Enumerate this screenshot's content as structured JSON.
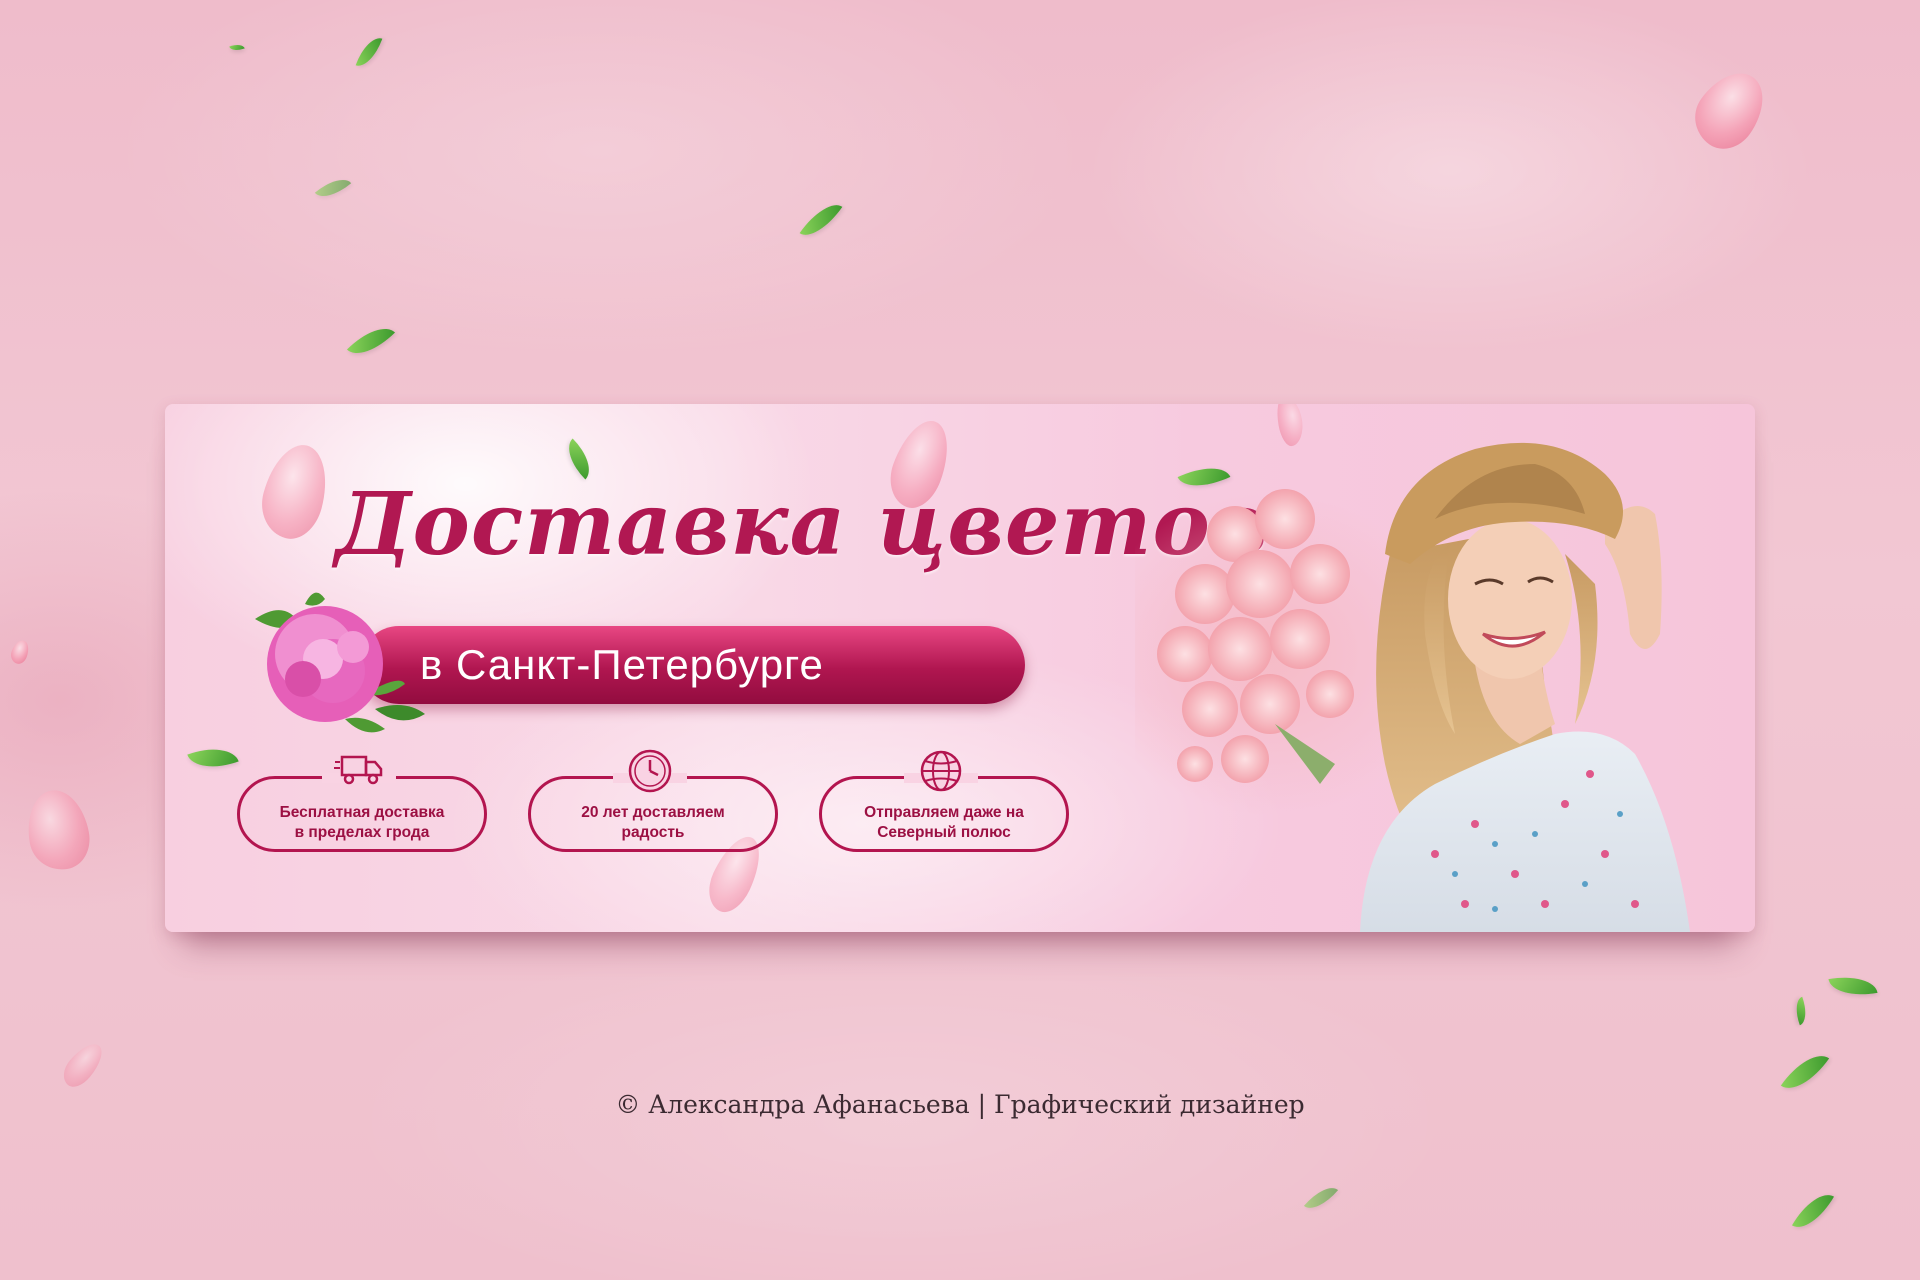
{
  "banner": {
    "title": "Доставка цветов",
    "subtitle": "в Санкт-Петербурге",
    "features": [
      {
        "icon": "truck-icon",
        "line1": "Бесплатная доставка",
        "line2": "в пределах грода"
      },
      {
        "icon": "clock-icon",
        "line1": "20 лет доставляем",
        "line2": "радость"
      },
      {
        "icon": "globe-icon",
        "line1": "Отправляем даже на",
        "line2": "Северный полюс"
      }
    ]
  },
  "footer": {
    "credit": "© Александра Афанасьева | Графический дизайнер"
  },
  "colors": {
    "accent": "#b3154f",
    "background": "#f2c7d3"
  }
}
